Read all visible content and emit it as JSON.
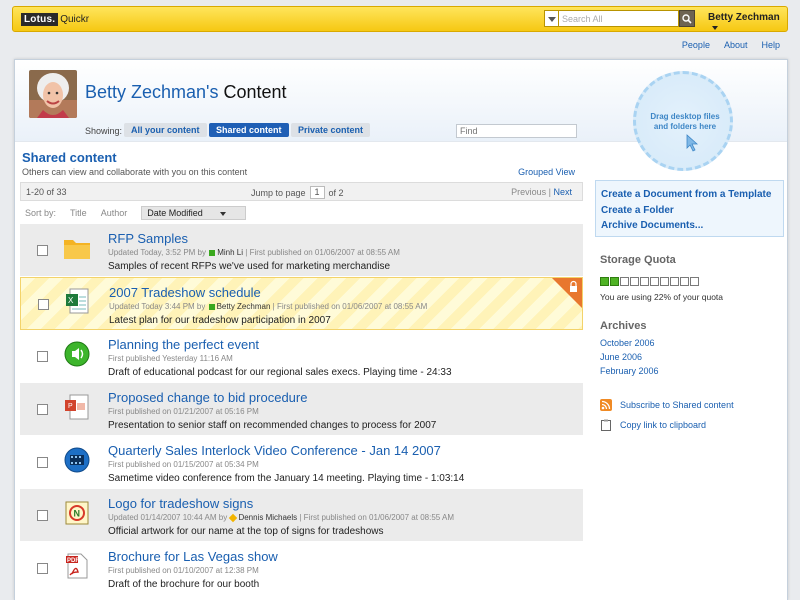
{
  "brand": {
    "lotus": "Lotus.",
    "product": "Quickr"
  },
  "search": {
    "placeholder": "Search All"
  },
  "user": {
    "name": "Betty Zechman"
  },
  "top_links": [
    "People",
    "About",
    "Help"
  ],
  "page": {
    "owner": "Betty Zechman's",
    "title_suffix": "Content",
    "showing_label": "Showing:",
    "tabs": [
      "All your content",
      "Shared content",
      "Private content"
    ],
    "active_tab": "Shared content",
    "find_placeholder": "Find"
  },
  "section": {
    "title": "Shared content",
    "subtitle": "Others can view and collaborate with you on this content",
    "grouped_view": "Grouped View"
  },
  "pager": {
    "range": "1-20 of 33",
    "jump_label": "Jump to page",
    "page": "1",
    "of_pages": "of 2",
    "previous": "Previous",
    "separator": "|",
    "next": "Next"
  },
  "sort": {
    "label": "Sort by:",
    "options": [
      "Title",
      "Author"
    ],
    "active": "Date Modified"
  },
  "items": [
    {
      "title": "RFP Samples",
      "meta_prefix": "Updated Today, 3:52 PM by",
      "meta_who": "Minh Li",
      "meta_suffix": "| First published on 01/06/2007 at 08:55 AM",
      "desc": "Samples of recent RFPs we've used for marketing merchandise",
      "icon": "folder-icon"
    },
    {
      "title": "2007 Tradeshow schedule",
      "meta_prefix": "Updated Today 3:44 PM by",
      "meta_who": "Betty Zechman",
      "meta_suffix": "| First published on 01/06/2007 at 08:55 AM",
      "desc": "Latest plan for our tradeshow participation in 2007",
      "icon": "spreadsheet-icon"
    },
    {
      "title": "Planning the perfect event",
      "meta_prefix": "First published Yesterday 11:16 AM",
      "meta_who": "",
      "meta_suffix": "",
      "desc": "Draft of educational podcast for our regional sales execs. Playing time - 24:33",
      "icon": "podcast-icon"
    },
    {
      "title": "Proposed change to bid procedure",
      "meta_prefix": "First published on 01/21/2007 at 05:16 PM",
      "meta_who": "",
      "meta_suffix": "",
      "desc": "Presentation to senior staff on recommended changes to process for 2007",
      "icon": "presentation-icon"
    },
    {
      "title": "Quarterly Sales Interlock Video Conference - Jan 14 2007",
      "meta_prefix": "First published on 01/15/2007 at 05:34 PM",
      "meta_who": "",
      "meta_suffix": "",
      "desc": "Sametime video conference from the January 14 meeting. Playing time - 1:03:14",
      "icon": "video-icon"
    },
    {
      "title": "Logo for tradeshow signs",
      "meta_prefix": "Updated 01/14/2007 10:44 AM by",
      "meta_who": "Dennis Michaels",
      "meta_suffix": "| First published on 01/06/2007 at 08:55 AM",
      "desc": "Official artwork for our name at the top of signs for tradeshows",
      "icon": "image-icon"
    },
    {
      "title": "Brochure for Las Vegas show",
      "meta_prefix": "First published on 01/10/2007 at 12:38 PM",
      "meta_who": "",
      "meta_suffix": "",
      "desc": "Draft of the brochure for our booth",
      "icon": "pdf-icon"
    }
  ],
  "drop_zone": {
    "text": "Drag desktop files and folders here"
  },
  "actions": [
    "Create a Document from a Template",
    "Create a Folder",
    "Archive Documents..."
  ],
  "quota": {
    "heading": "Storage Quota",
    "used_fraction": 0.22,
    "text": "You are using 22% of your quota"
  },
  "archives": {
    "heading": "Archives",
    "links": [
      "October 2006",
      "June 2006",
      "February 2006"
    ]
  },
  "side_links": [
    "Subscribe to Shared content",
    "Copy link to clipboard"
  ],
  "colors": {
    "accent": "#1a5fb0",
    "topbar": "#f6c812",
    "highlight_row": "#fff7c4",
    "online": "#3aa81e"
  }
}
